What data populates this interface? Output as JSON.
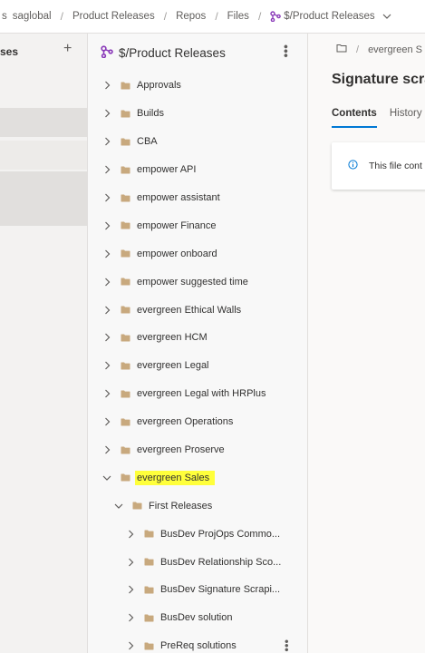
{
  "breadcrumb": {
    "items": [
      "s",
      "saglobal",
      "Product Releases",
      "Repos",
      "Files",
      "$/Product Releases"
    ]
  },
  "left_panel": {
    "title": "ses",
    "add_label": "+"
  },
  "tree": {
    "title": "$/Product Releases",
    "items": [
      {
        "label": "Approvals",
        "level": 0,
        "expanded": false
      },
      {
        "label": "Builds",
        "level": 0,
        "expanded": false
      },
      {
        "label": "CBA",
        "level": 0,
        "expanded": false
      },
      {
        "label": "empower API",
        "level": 0,
        "expanded": false
      },
      {
        "label": "empower assistant",
        "level": 0,
        "expanded": false
      },
      {
        "label": "empower Finance",
        "level": 0,
        "expanded": false
      },
      {
        "label": "empower onboard",
        "level": 0,
        "expanded": false
      },
      {
        "label": "empower suggested time",
        "level": 0,
        "expanded": false
      },
      {
        "label": "evergreen Ethical Walls",
        "level": 0,
        "expanded": false
      },
      {
        "label": "evergreen HCM",
        "level": 0,
        "expanded": false
      },
      {
        "label": "evergreen Legal",
        "level": 0,
        "expanded": false
      },
      {
        "label": "evergreen Legal with HRPlus",
        "level": 0,
        "expanded": false
      },
      {
        "label": "evergreen Operations",
        "level": 0,
        "expanded": false
      },
      {
        "label": "evergreen Proserve",
        "level": 0,
        "expanded": false
      },
      {
        "label": "evergreen Sales",
        "level": 0,
        "expanded": true,
        "highlighted": true
      },
      {
        "label": "First Releases",
        "level": 1,
        "expanded": true
      },
      {
        "label": "BusDev ProjOps Commo...",
        "level": 2,
        "expanded": false
      },
      {
        "label": "BusDev Relationship Sco...",
        "level": 2,
        "expanded": false
      },
      {
        "label": "BusDev Signature Scrapi...",
        "level": 2,
        "expanded": false
      },
      {
        "label": "BusDev solution",
        "level": 2,
        "expanded": false
      },
      {
        "label": "PreReq solutions",
        "level": 2,
        "expanded": false,
        "has_more": true
      }
    ]
  },
  "content": {
    "breadcrumb_text": "evergreen S",
    "breadcrumb_sep": "/",
    "title": "Signature scra",
    "tabs": [
      {
        "label": "Contents",
        "active": true
      },
      {
        "label": "History",
        "active": false
      }
    ],
    "notice": "This file cont"
  },
  "colors": {
    "accent": "#0078d4",
    "folder": "#c8a97e",
    "highlight": "#ffff3b",
    "repo_icon": "#8a3ab9"
  }
}
